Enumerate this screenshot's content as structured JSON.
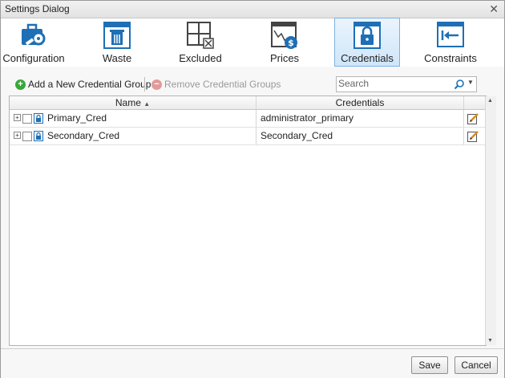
{
  "window": {
    "title": "Settings Dialog",
    "close_glyph": "✕"
  },
  "tabs": [
    {
      "label": "Configuration",
      "icon": "briefcase-gear-icon"
    },
    {
      "label": "Waste",
      "icon": "trash-can-icon"
    },
    {
      "label": "Excluded",
      "icon": "grid-excluded-icon"
    },
    {
      "label": "Prices",
      "icon": "price-chart-icon"
    },
    {
      "label": "Credentials",
      "icon": "lock-icon",
      "active": true
    },
    {
      "label": "Constraints",
      "icon": "arrow-constraint-icon"
    }
  ],
  "toolbar": {
    "add_label": "Add a New Credential Group",
    "remove_label": "Remove Credential Groups",
    "search_placeholder": "Search"
  },
  "table": {
    "columns": [
      "Name",
      "Credentials"
    ],
    "rows": [
      {
        "name": "Primary_Cred",
        "credentials": "administrator_primary"
      },
      {
        "name": "Secondary_Cred",
        "credentials": "Secondary_Cred"
      }
    ]
  },
  "footer": {
    "save_label": "Save",
    "cancel_label": "Cancel"
  },
  "colors": {
    "accent": "#1e6fb5",
    "active_tab_bg": "#cfe6fa",
    "add_green": "#3aa63a",
    "remove_red": "#e39a9a"
  }
}
